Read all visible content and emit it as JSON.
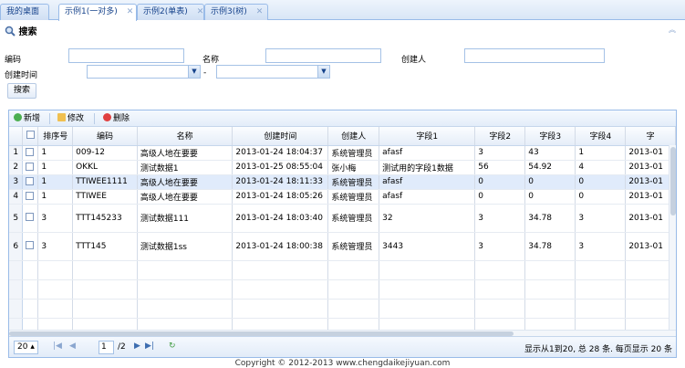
{
  "tabs": [
    {
      "label": "我的桌面",
      "closable": false
    },
    {
      "label": "示例1(一对多)",
      "closable": true
    },
    {
      "label": "示例2(单表)",
      "closable": true
    },
    {
      "label": "示例3(树)",
      "closable": true
    }
  ],
  "search": {
    "title": "搜索",
    "fields": {
      "code_label": "编码",
      "name_label": "名称",
      "creator_label": "创建人",
      "created_time_label": "创建时间",
      "range_sep": "-"
    },
    "button_label": "搜索"
  },
  "toolbar": {
    "add": "新增",
    "edit": "修改",
    "delete": "删除"
  },
  "grid": {
    "columns": [
      "",
      "排序号",
      "编码",
      "名称",
      "创建时间",
      "创建人",
      "字段1",
      "字段2",
      "字段3",
      "字段4",
      "字"
    ],
    "rows": [
      {
        "rn": "1",
        "sort": "1",
        "code": "009-12",
        "name": "高级人地在要要",
        "time": "2013-01-24 18:04:37",
        "creator": "系统管理员",
        "f1": "afasf",
        "f2": "3",
        "f3": "43",
        "f4": "1",
        "f5": "2013-01"
      },
      {
        "rn": "2",
        "sort": "1",
        "code": "OKKL",
        "name": "测试数据1",
        "time": "2013-01-25 08:55:04",
        "creator": "张小梅",
        "f1": "测试用的字段1数据",
        "f2": "56",
        "f3": "54.92",
        "f4": "4",
        "f5": "2013-01"
      },
      {
        "rn": "3",
        "sort": "1",
        "code": "TTIWEE1111",
        "name": "高级人地在要要",
        "time": "2013-01-24 18:11:33",
        "creator": "系统管理员",
        "f1": "afasf",
        "f2": "0",
        "f3": "0",
        "f4": "0",
        "f5": "2013-01"
      },
      {
        "rn": "4",
        "sort": "1",
        "code": "TTIWEE",
        "name": "高级人地在要要",
        "time": "2013-01-24 18:05:26",
        "creator": "系统管理员",
        "f1": "afasf",
        "f2": "0",
        "f3": "0",
        "f4": "0",
        "f5": "2013-01"
      },
      {
        "rn": "5",
        "sort": "3",
        "code": "TTT145233",
        "name": "测试数据111",
        "time": "2013-01-24 18:03:40",
        "creator": "系统管理员",
        "f1": "32",
        "f2": "3",
        "f3": "34.78",
        "f4": "3",
        "f5": "2013-01"
      },
      {
        "rn": "6",
        "sort": "3",
        "code": "TTT145",
        "name": "测试数据1ss",
        "time": "2013-01-24 18:00:38",
        "creator": "系统管理员",
        "f1": "3443",
        "f2": "3",
        "f3": "34.78",
        "f4": "3",
        "f5": "2013-01"
      }
    ]
  },
  "pager": {
    "page_size": "20",
    "current_page": "1",
    "total_pages": "/2",
    "info": "显示从1到20, 总 28 条. 每页显示 20 条"
  },
  "footer": "Copyright © 2012-2013 www.chengdaikejiyuan.com",
  "colors": {
    "accent": "#99bbe8",
    "selected_row": "#e0ebfb",
    "tab_text": "#15428b"
  }
}
